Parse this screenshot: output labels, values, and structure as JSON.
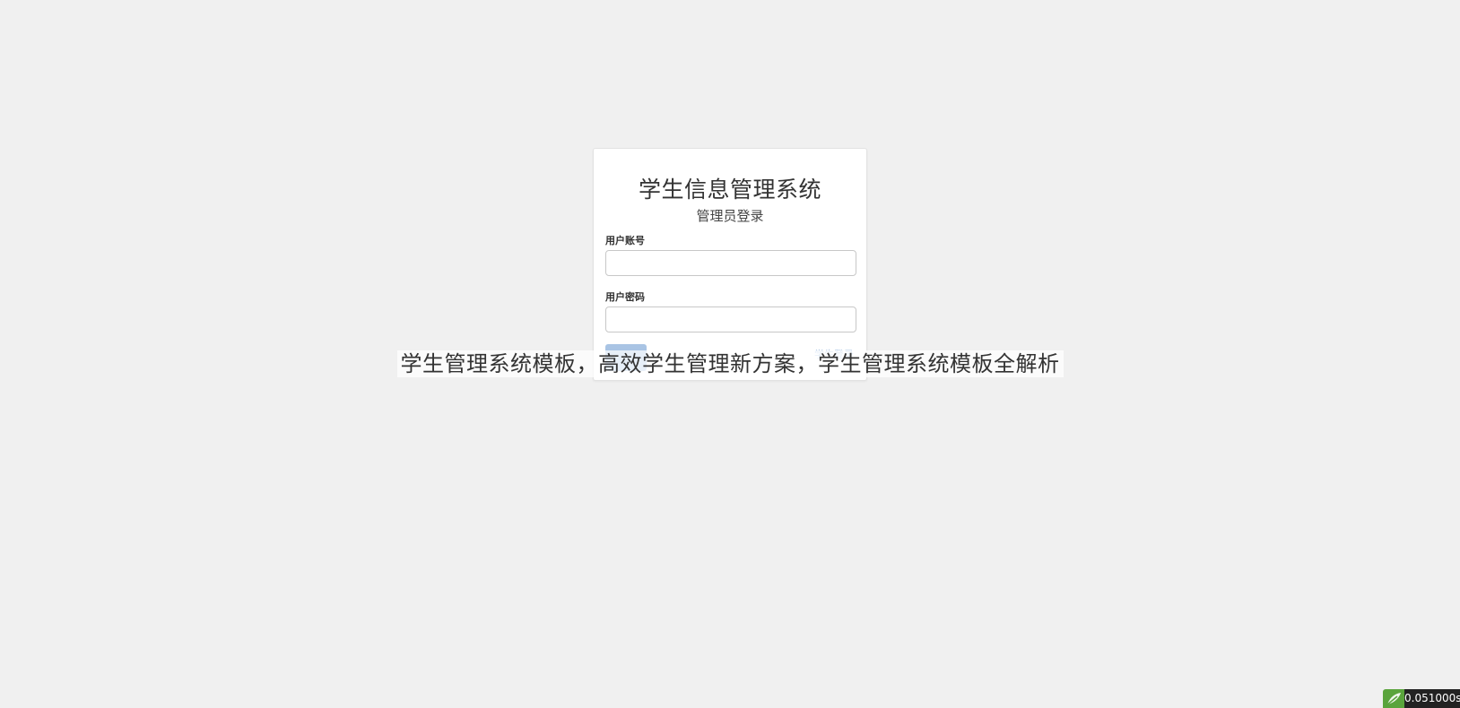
{
  "login": {
    "title": "学生信息管理系统",
    "subtitle": "管理员登录",
    "username_label": "用户账号",
    "username_value": "",
    "password_label": "用户密码",
    "password_value": "",
    "login_button_label": "",
    "student_login_link": "学生登录"
  },
  "overlay": {
    "caption": "学生管理系统模板，高效学生管理新方案，学生管理系统模板全解析"
  },
  "corner": {
    "logo_icon": "leaf-logo-icon",
    "timer_text": "0.051000s"
  },
  "colors": {
    "background": "#f0f0f0",
    "card": "#ffffff",
    "button": "#a9c4e4",
    "timer_bg": "#222222",
    "logo_green": "#5aa43c"
  }
}
